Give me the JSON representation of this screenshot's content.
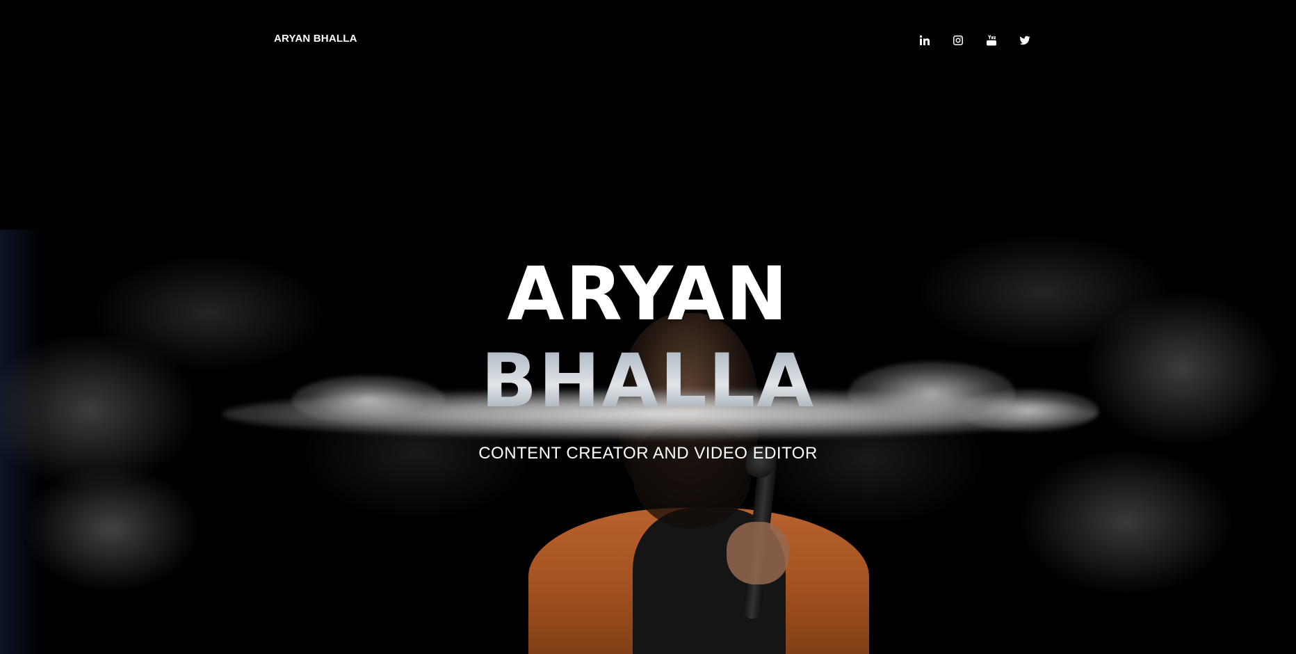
{
  "nav": {
    "brand": "ARYAN BHALLA",
    "social": [
      {
        "name": "linkedin-icon",
        "label": "LinkedIn"
      },
      {
        "name": "instagram-icon",
        "label": "Instagram"
      },
      {
        "name": "youtube-icon",
        "label": "YouTube"
      },
      {
        "name": "twitter-icon",
        "label": "Twitter"
      }
    ]
  },
  "hero": {
    "first_name": "ARYAN",
    "last_name": "BHALLA",
    "subtitle": "CONTENT CREATOR AND VIDEO EDITOR"
  },
  "colors": {
    "background": "#000000",
    "hoodie": "#b8622e",
    "text": "#ffffff"
  }
}
